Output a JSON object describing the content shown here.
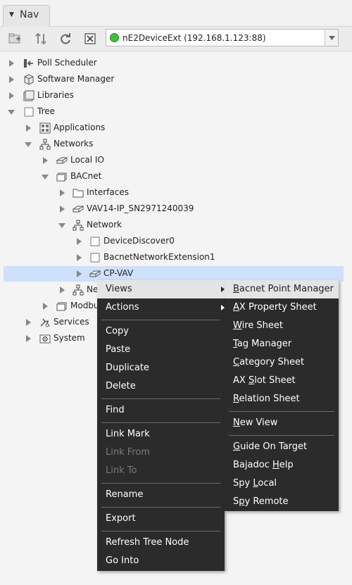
{
  "panel": {
    "tab_title": "Nav"
  },
  "toolbar": {
    "station_selector": "nE2DeviceExt (192.168.1.123:88)",
    "icons": [
      "new-station-icon",
      "sort-icon",
      "refresh-icon",
      "close-icon"
    ]
  },
  "tree": {
    "poll_scheduler": "Poll Scheduler",
    "software_manager": "Software Manager",
    "libraries": "Libraries",
    "tree": "Tree",
    "applications": "Applications",
    "networks": "Networks",
    "local_io": "Local IO",
    "bacnet": "BACnet",
    "interfaces": "Interfaces",
    "vav14": "VAV14-IP_SN2971240039",
    "network": "Network",
    "device_discover": "DeviceDiscover0",
    "bacnet_network_ext": "BacnetNetworkExtension1",
    "cp_vav": "CP-VAV",
    "ne_partial": "Ne",
    "modbus_partial": "Modbu",
    "services": "Services",
    "system": "System"
  },
  "context_menu": {
    "views": "Views",
    "actions": "Actions",
    "copy": "Copy",
    "paste": "Paste",
    "duplicate": "Duplicate",
    "delete": "Delete",
    "find": "Find",
    "link_mark": "Link Mark",
    "link_from": "Link From",
    "link_to": "Link To",
    "rename": "Rename",
    "export": "Export",
    "refresh_tree_node": "Refresh Tree Node",
    "go_into": "Go Into"
  },
  "views_submenu": {
    "bacnet_point_manager": {
      "mnemonic": "B",
      "rest": "acnet Point Manager"
    },
    "ax_property_sheet": {
      "mnemonic": "A",
      "rest": "X Property Sheet"
    },
    "wire_sheet": {
      "mnemonic": "W",
      "rest": "ire Sheet"
    },
    "tag_manager": {
      "mnemonic": "T",
      "rest": "ag Manager"
    },
    "category_sheet": {
      "mnemonic": "C",
      "rest": "ategory Sheet"
    },
    "ax_slot_sheet": {
      "pre": "AX ",
      "mnemonic": "S",
      "rest": "lot Sheet"
    },
    "relation_sheet": {
      "mnemonic": "R",
      "rest": "elation Sheet"
    },
    "new_view": {
      "mnemonic": "N",
      "rest": "ew View"
    },
    "guide_on_target": {
      "mnemonic": "G",
      "rest": "uide On Target"
    },
    "bajadoc_help": {
      "pre": "Bajadoc ",
      "mnemonic": "H",
      "rest": "elp"
    },
    "spy_local": {
      "pre": "Spy ",
      "mnemonic": "L",
      "rest": "ocal"
    },
    "spy_remote": {
      "pre": "S",
      "mnemonic": "p",
      "rest": "y Remote"
    }
  },
  "colors": {
    "menu_bg": "#2b2b2b",
    "menu_hover": "#e4e4e4",
    "selection": "#cfe0fa",
    "status_ok": "#3fbf3f"
  }
}
